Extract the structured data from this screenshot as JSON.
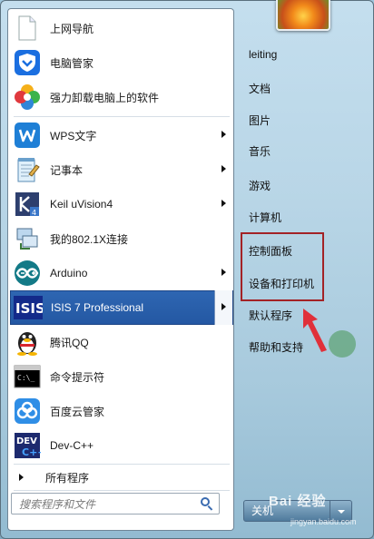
{
  "menu": {
    "items": [
      {
        "label": "上网导航",
        "icon": "page-icon",
        "arrow": false
      },
      {
        "label": "电脑管家",
        "icon": "tencent-shield-icon",
        "arrow": false
      },
      {
        "label": "强力卸载电脑上的软件",
        "icon": "uninstall-flower-icon",
        "arrow": false
      },
      {
        "label": "WPS文字",
        "icon": "wps-icon",
        "arrow": true
      },
      {
        "label": "记事本",
        "icon": "notepad-icon",
        "arrow": true
      },
      {
        "label": "Keil uVision4",
        "icon": "keil-icon",
        "arrow": true
      },
      {
        "label": "我的802.1X连接",
        "icon": "network-icon",
        "arrow": false
      },
      {
        "label": "Arduino",
        "icon": "arduino-icon",
        "arrow": true
      },
      {
        "label": "ISIS 7 Professional",
        "icon": "isis-icon",
        "arrow": true,
        "selected": true
      },
      {
        "label": "腾讯QQ",
        "icon": "qq-penguin-icon",
        "arrow": false
      },
      {
        "label": "命令提示符",
        "icon": "cmd-icon",
        "arrow": false
      },
      {
        "label": "百度云管家",
        "icon": "baidu-cloud-icon",
        "arrow": false
      },
      {
        "label": "Dev-C++",
        "icon": "devcpp-icon",
        "arrow": false
      }
    ],
    "all_programs": "所有程序",
    "search_placeholder": "搜索程序和文件"
  },
  "right": {
    "links": [
      "leiting",
      "文档",
      "图片",
      "音乐",
      "游戏",
      "计算机",
      "控制面板",
      "设备和打印机",
      "默认程序",
      "帮助和支持"
    ],
    "shutdown_label": "关机"
  },
  "watermark": {
    "main": "Bai 经验",
    "sub": "jingyan.baidu.com"
  },
  "colors": {
    "highlight_box": "#a32226",
    "selected_item": "#2e66b2",
    "annotation_arrow": "#e0303a"
  }
}
